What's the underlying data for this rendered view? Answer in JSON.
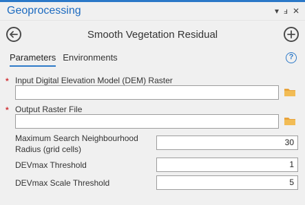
{
  "pane": {
    "title": "Geoprocessing",
    "controls": {
      "dropdown": "▾",
      "pin": "ⅎ",
      "close": "✕"
    }
  },
  "tool": {
    "title": "Smooth Vegetation Residual"
  },
  "tabs": [
    {
      "label": "Parameters",
      "active": true
    },
    {
      "label": "Environments",
      "active": false
    }
  ],
  "help": {
    "glyph": "?"
  },
  "parameters": {
    "dem_raster": {
      "required_mark": "*",
      "label": "Input Digital Elevation Model (DEM) Raster",
      "value": ""
    },
    "output_raster": {
      "required_mark": "*",
      "label": "Output Raster File",
      "value": ""
    },
    "max_search": {
      "label_line1": "Maximum Search Neighbourhood",
      "label_line2": "Radius (grid cells)",
      "value": "30"
    },
    "devmax_threshold": {
      "label": "DEVmax Threshold",
      "value": "1"
    },
    "devmax_scale_threshold": {
      "label": "DEVmax Scale Threshold",
      "value": "5"
    }
  },
  "colors": {
    "accent": "#2b78c8",
    "required": "#d13438",
    "folder": "#e8a33a"
  },
  "icons": [
    "back-arrow-icon",
    "add-circle-icon",
    "help-icon",
    "folder-icon"
  ]
}
